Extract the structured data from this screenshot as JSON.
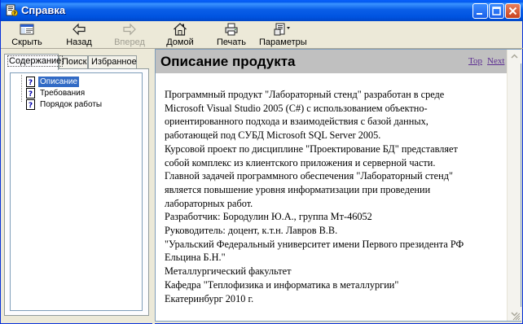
{
  "window": {
    "title": "Справка",
    "colors": {
      "titlebar": "#0058ee",
      "selection": "#316ac5",
      "link": "#5c2d91",
      "header": "#c0c0c0"
    }
  },
  "toolbar": {
    "items": [
      {
        "label": "Скрыть",
        "icon": "hide-pane-icon",
        "enabled": true
      },
      {
        "label": "Назад",
        "icon": "back-arrow-icon",
        "enabled": true
      },
      {
        "label": "Вперед",
        "icon": "forward-arrow-icon",
        "enabled": false
      },
      {
        "label": "Домой",
        "icon": "home-icon",
        "enabled": true
      },
      {
        "label": "Печать",
        "icon": "print-icon",
        "enabled": true
      },
      {
        "label": "Параметры",
        "icon": "options-icon",
        "enabled": true
      }
    ]
  },
  "nav": {
    "tabs": [
      "Содержание",
      "Поиск",
      "Избранное"
    ],
    "active_tab": "Содержание",
    "tree": [
      {
        "label": "Описание",
        "icon": "help-topic-icon",
        "selected": true
      },
      {
        "label": "Требования",
        "icon": "help-topic-icon",
        "selected": false
      },
      {
        "label": "Порядок работы",
        "icon": "help-topic-icon",
        "selected": false
      }
    ]
  },
  "content": {
    "title": "Описание продукта",
    "top_link": "Top",
    "next_link": "Next",
    "lines": [
      "Программный продукт \"Лабораторный стенд\" разработан в среде",
      "Microsoft Visual Studio 2005 (C#) с использованием объектно-",
      "ориентированного подхода и взаимодействия с базой данных,",
      "работающей под СУБД Microsoft SQL Server 2005.",
      "Курсовой проект по дисциплине \"Проектирование БД\" представляет",
      "собой комплекс из клиентского приложения и серверной части.",
      "Главной задачей программного обеспечения \"Лабораторный стенд\"",
      "является повышение уровня информатизации при проведении",
      "лабораторных работ.",
      "Разработчик: Бородулин Ю.А., группа Мт-46052",
      "Руководитель: доцент, к.т.н. Лавров В.В.",
      "\"Уральский Федеральный университет имени Первого президента РФ",
      "Ельцина Б.Н.\"",
      "Металлургический факультет",
      "Кафедра \"Теплофизика и информатика в металлургии\"",
      "Екатеринбург 2010 г."
    ]
  }
}
